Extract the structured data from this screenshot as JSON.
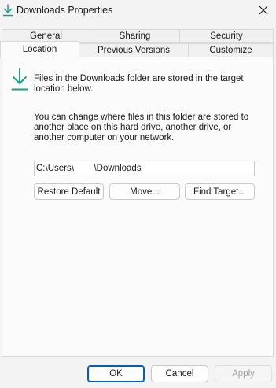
{
  "window": {
    "title": "Downloads Properties"
  },
  "tabs": {
    "row1": [
      "General",
      "Sharing",
      "Security"
    ],
    "row2": [
      "Location",
      "Previous Versions",
      "Customize"
    ]
  },
  "location": {
    "info_line1": "Files in the Downloads folder are stored in the target location below.",
    "info_line2": "You can change where files in this folder are stored to another place on this hard drive, another drive, or another computer on your network.",
    "path_value": "C:\\Users\\        \\Downloads",
    "buttons": {
      "restore": "Restore Default",
      "move": "Move...",
      "find": "Find Target..."
    }
  },
  "footer": {
    "ok": "OK",
    "cancel": "Cancel",
    "apply": "Apply"
  },
  "colors": {
    "accent": "#005fb8",
    "icon_teal": "#19a08a"
  },
  "icons": {
    "app": "download-arrow-icon",
    "close": "close-icon",
    "folder_location": "download-arrow-icon"
  }
}
